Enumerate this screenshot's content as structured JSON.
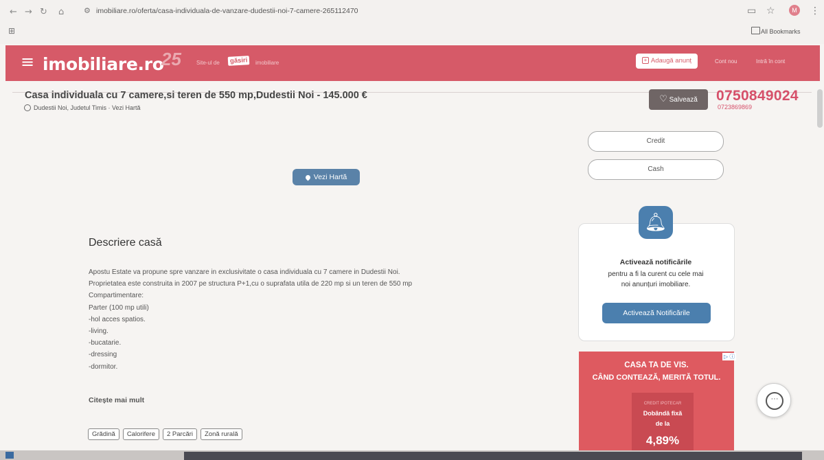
{
  "browser": {
    "url": "imobiliare.ro/oferta/casa-individuala-de-vanzare-dudestii-noi-7-camere-265112470",
    "bookmarks_label": "All Bookmarks",
    "profile_initial": "M",
    "nav_icons": [
      "back-icon",
      "forward-icon",
      "reload-icon",
      "home-icon"
    ],
    "right_icons": [
      "cast-icon",
      "star-icon",
      "profile-avatar",
      "menu-icon"
    ]
  },
  "header": {
    "logo": "imobiliare.ro",
    "badge": "25",
    "slogan_pre": "Site-ul de",
    "slogan_box": "găsiri",
    "slogan_post": "imobiliare",
    "add_listing": "Adaugă anunț",
    "new_account": "Cont nou",
    "login": "Intră în cont",
    "brand_color": "#d65a68"
  },
  "listing": {
    "title": "Casa individuala cu 7 camere,si teren de 550 mp,Dudestii Noi - 145.000 €",
    "location": "Dudestii Noi, Judetul Timis · Vezi Hartă",
    "save": "Salvează",
    "phone_main": "0750849024",
    "phone_alt": "0723869869"
  },
  "map": {
    "button": "Vezi Hartă"
  },
  "sidebar": {
    "credit": "Credit",
    "cash": "Cash",
    "notif_title": "Activează notificările",
    "notif_text_1": "pentru a fi la curent cu cele mai",
    "notif_text_2": "noi anunțuri imobiliare.",
    "notif_button": "Activează Notificările",
    "accent_color": "#4b7fae"
  },
  "ad": {
    "line1": "CASA TA DE VIS.",
    "line2": "CÂND CONTEAZĂ, MERITĂ TOTUL.",
    "small": "CREDIT IPOTECAR",
    "fix": "Dobândă fixă",
    "de_la": "de la",
    "rate": "4,89%"
  },
  "description": {
    "heading": "Descriere casă",
    "lines": [
      "Apostu Estate va propune spre vanzare in exclusivitate o casa individuala cu 7 camere in Dudestii Noi.",
      "Proprietatea este construita in 2007 pe structura P+1,cu o suprafata utila de 220 mp si un teren de 550 mp",
      "Compartimentare:",
      "Parter (100 mp utili)",
      "-hol acces spatios.",
      "-living.",
      "-bucatarie.",
      "-dressing",
      "-dormitor."
    ],
    "read_more": "Citește mai mult",
    "tags": [
      "Grădină",
      "Calorifere",
      "2 Parcări",
      "Zonă rurală"
    ]
  }
}
